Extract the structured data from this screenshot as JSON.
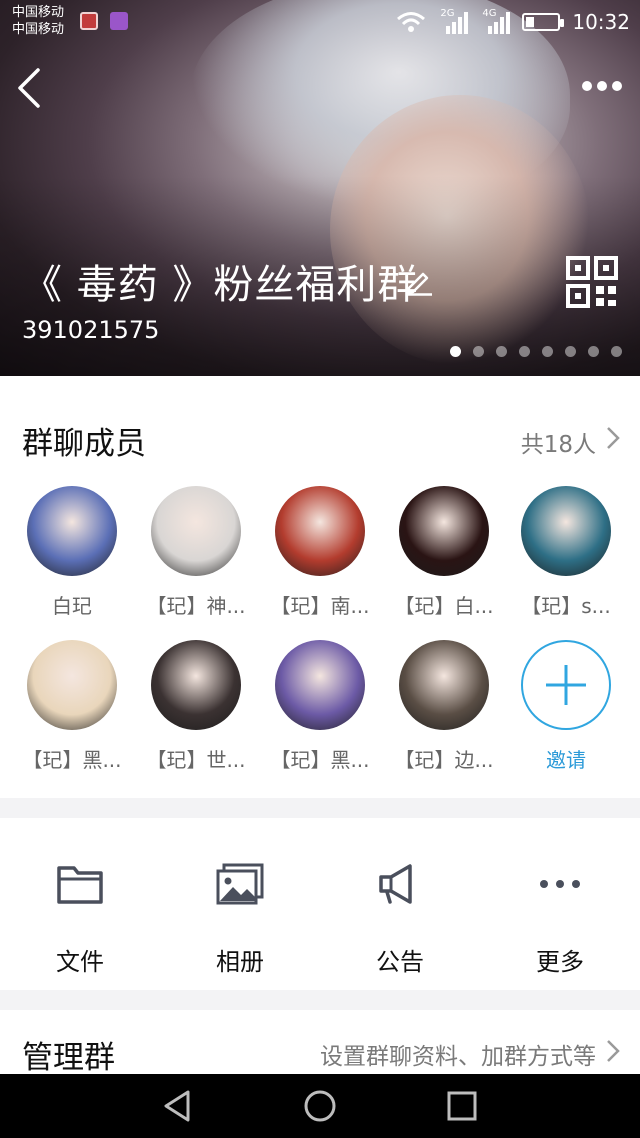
{
  "status_bar": {
    "carrier_line1": "中国移动",
    "carrier_line2": "中国移动",
    "net1": "2G",
    "net2": "4G",
    "time": "10:32"
  },
  "header": {
    "group_name": "《 毒药 》粉丝福利群",
    "group_id": "391021575",
    "carousel_total": 8,
    "carousel_active": 0
  },
  "members": {
    "title": "群聊成员",
    "count": "共18人",
    "list": [
      {
        "name": "白玘",
        "color": "#5b6fb6"
      },
      {
        "name": "【玘】神...",
        "color": "#d9d6d4"
      },
      {
        "name": "【玘】南...",
        "color": "#b33c2e"
      },
      {
        "name": "【玘】白...",
        "color": "#2a1414"
      },
      {
        "name": "【玘】s...",
        "color": "#2e6f86"
      },
      {
        "name": "【玘】黑...",
        "color": "#e9d6bb"
      },
      {
        "name": "【玘】世...",
        "color": "#3b3232"
      },
      {
        "name": "【玘】黑...",
        "color": "#6c5aa6"
      },
      {
        "name": "【玘】边...",
        "color": "#5a4e45"
      }
    ],
    "invite_label": "邀请"
  },
  "tools": [
    {
      "label": "文件",
      "icon": "folder-icon"
    },
    {
      "label": "相册",
      "icon": "album-icon"
    },
    {
      "label": "公告",
      "icon": "megaphone-icon"
    },
    {
      "label": "更多",
      "icon": "more-dots-icon"
    }
  ],
  "manage": {
    "title": "管理群",
    "desc": "设置群聊资料、加群方式等"
  },
  "colors": {
    "accent": "#2b9ad8",
    "icon_gray": "#4a4f5c"
  }
}
